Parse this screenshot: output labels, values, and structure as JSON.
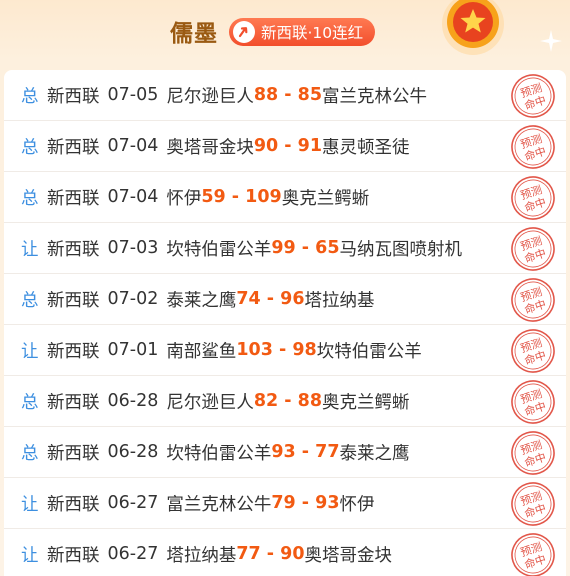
{
  "header": {
    "author": "儒墨",
    "streak_label": "新西联·10连红"
  },
  "stamp_text": [
    "预测",
    "命中"
  ],
  "colors": {
    "score": "#f25a12",
    "type_tag": "#3d8fe0",
    "author": "#9a5a12",
    "stamp": "#e2574a"
  },
  "rows": [
    {
      "type": "总",
      "league": "新西联",
      "date": "07-05",
      "home": "尼尔逊巨人",
      "home_score": "88",
      "sep": " - ",
      "away_score": "85",
      "away": "富兰克林公牛"
    },
    {
      "type": "总",
      "league": "新西联",
      "date": "07-04",
      "home": "奥塔哥金块",
      "home_score": "90",
      "sep": " - ",
      "away_score": "91",
      "away": "惠灵顿圣徒"
    },
    {
      "type": "总",
      "league": "新西联",
      "date": "07-04",
      "home": "怀伊",
      "home_score": "59",
      "sep": " - ",
      "away_score": "109",
      "away": "奥克兰鳄蜥"
    },
    {
      "type": "让",
      "league": "新西联",
      "date": "07-03",
      "home": "坎特伯雷公羊",
      "home_score": "99",
      "sep": " - ",
      "away_score": "65",
      "away": "马纳瓦图喷射机"
    },
    {
      "type": "总",
      "league": "新西联",
      "date": "07-02",
      "home": "泰莱之鹰",
      "home_score": "74",
      "sep": " - ",
      "away_score": "96",
      "away": "塔拉纳基"
    },
    {
      "type": "让",
      "league": "新西联",
      "date": "07-01",
      "home": "南部鲨鱼",
      "home_score": "103",
      "sep": " - ",
      "away_score": "98",
      "away": "坎特伯雷公羊"
    },
    {
      "type": "总",
      "league": "新西联",
      "date": "06-28",
      "home": "尼尔逊巨人",
      "home_score": "82",
      "sep": " - ",
      "away_score": "88",
      "away": "奥克兰鳄蜥"
    },
    {
      "type": "总",
      "league": "新西联",
      "date": "06-28",
      "home": "坎特伯雷公羊",
      "home_score": "93",
      "sep": " - ",
      "away_score": "77",
      "away": "泰莱之鹰"
    },
    {
      "type": "让",
      "league": "新西联",
      "date": "06-27",
      "home": "富兰克林公牛",
      "home_score": "79",
      "sep": " - ",
      "away_score": "93",
      "away": "怀伊"
    },
    {
      "type": "让",
      "league": "新西联",
      "date": "06-27",
      "home": "塔拉纳基",
      "home_score": "77",
      "sep": " - ",
      "away_score": "90",
      "away": "奥塔哥金块"
    }
  ]
}
